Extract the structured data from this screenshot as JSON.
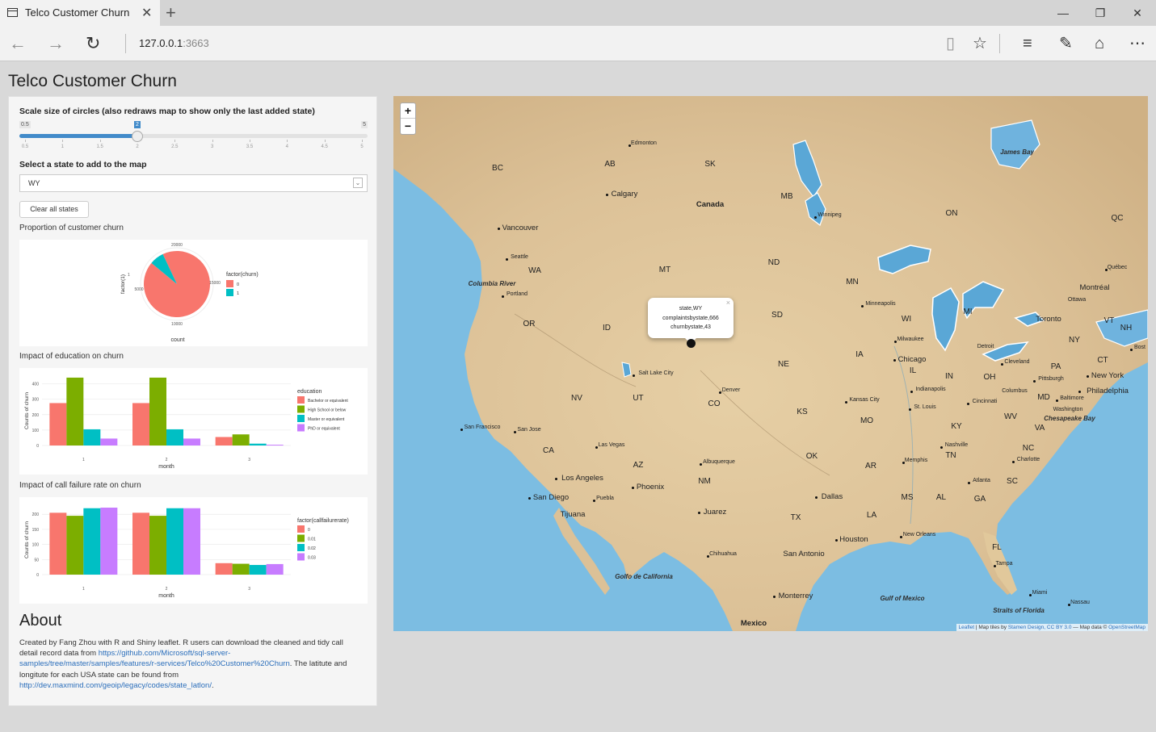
{
  "browser": {
    "tab_title": "Telco Customer Churn",
    "url_host": "127.0.0.1",
    "url_port": ":3663"
  },
  "page": {
    "title": "Telco Customer Churn"
  },
  "controls": {
    "slider_label": "Scale size of circles (also redraws map to show only the last added state)",
    "slider_min": "0.5",
    "slider_max": "5",
    "slider_value": "2",
    "slider_ticks": [
      "0.5",
      "1",
      "1.5",
      "2",
      "2.5",
      "3",
      "3.5",
      "4",
      "4.5",
      "5"
    ],
    "state_label": "Select a state to add to the map",
    "state_value": "WY",
    "clear_button": "Clear all states"
  },
  "charts": {
    "pie_title": "Proportion of customer churn",
    "edu_title": "Impact of education on churn",
    "cf_title": "Impact of call failure rate on churn"
  },
  "chart_data": [
    {
      "type": "pie",
      "xlabel": "count",
      "ylabel": "factor(1)",
      "y_tick": "1",
      "ticks": [
        "20000",
        "5000",
        "10000",
        "15000"
      ],
      "legend_title": "factor(churn)",
      "series": [
        {
          "name": "0",
          "values": [
            18600
          ],
          "color": "#F8766D"
        },
        {
          "name": "1",
          "values": [
            1400
          ],
          "color": "#00BFC4"
        }
      ]
    },
    {
      "type": "bar",
      "categories": [
        "1",
        "2",
        "3"
      ],
      "xlabel": "month",
      "ylabel": "Counts of churn",
      "ylim": [
        0,
        450
      ],
      "yticks": [
        "0",
        "100",
        "200",
        "300",
        "400"
      ],
      "legend_title": "education",
      "series": [
        {
          "name": "Bachelor or equivalent",
          "values": [
            275,
            275,
            55
          ],
          "color": "#F8766D"
        },
        {
          "name": "High School or below",
          "values": [
            440,
            440,
            72
          ],
          "color": "#7CAE00"
        },
        {
          "name": "Master or equivalent",
          "values": [
            105,
            105,
            12
          ],
          "color": "#00BFC4"
        },
        {
          "name": "PhD or equivalent",
          "values": [
            45,
            45,
            5
          ],
          "color": "#C77CFF"
        }
      ]
    },
    {
      "type": "bar",
      "categories": [
        "1",
        "2",
        "3"
      ],
      "xlabel": "month",
      "ylabel": "Counts of churn",
      "ylim": [
        0,
        230
      ],
      "yticks": [
        "0",
        "50",
        "100",
        "150",
        "200"
      ],
      "legend_title": "factor(callfailurerate)",
      "series": [
        {
          "name": "0",
          "values": [
            205,
            205,
            38
          ],
          "color": "#F8766D"
        },
        {
          "name": "0.01",
          "values": [
            195,
            195,
            36
          ],
          "color": "#7CAE00"
        },
        {
          "name": "0.02",
          "values": [
            220,
            220,
            32
          ],
          "color": "#00BFC4"
        },
        {
          "name": "0.03",
          "values": [
            222,
            220,
            35
          ],
          "color": "#C77CFF"
        }
      ]
    }
  ],
  "about": {
    "heading": "About",
    "text1": "Created by Fang Zhou with R and Shiny leaflet. R users can download the cleaned and tidy call detail record data from ",
    "link1": "https://github.com/Microsoft/sql-server-samples/tree/master/samples/features/r-services/Telco%20Customer%20Churn",
    "text2": ". The latitute and longitute for each USA state can be found from ",
    "link2": "http://dev.maxmind.com/geoip/legacy/codes/state_latlon/",
    "text3": "."
  },
  "map": {
    "zoom_in": "+",
    "zoom_out": "−",
    "popup_close": "×",
    "popup_lines": [
      "state,WY",
      "complaintsbystate,666",
      "churnbystate,43"
    ],
    "attribution_pre": "Leaflet",
    "attribution_mid": " | Map tiles by ",
    "attribution_link": "Stamen Design, CC BY 3.0",
    "attribution_post": " — Map data © ",
    "attribution_osm": "OpenStreetMap",
    "labels": [
      "Edmonton",
      "James Bay",
      "BC",
      "AB",
      "SK",
      "Calgary",
      "Canada",
      "MB",
      "Winnipeg",
      "ON",
      "QC",
      "Vancouver",
      "Seattle",
      "WA",
      "Columbia River",
      "Portland",
      "OR",
      "ID",
      "MT",
      "ND",
      "MN",
      "Minneapolis",
      "Québec",
      "Montréal",
      "Ottawa",
      "SD",
      "WI",
      "MI",
      "Toronto",
      "VT",
      "NH",
      "Milwaukee",
      "Detroit",
      "NY",
      "Bost",
      "CT",
      "Salt Lake City",
      "NE",
      "IA",
      "Chicago",
      "IL",
      "Cleveland",
      "PA",
      "New York",
      "IN",
      "OH",
      "Pittsburgh",
      "Philadelphia",
      "Denver",
      "Indianapolis",
      "Columbus",
      "Baltimore",
      "MD",
      "NV",
      "UT",
      "CO",
      "Kansas City",
      "KS",
      "St. Louis",
      "Cincinnati",
      "Washington",
      "WV",
      "Chesapeake Bay",
      "MO",
      "KY",
      "VA",
      "San Francisco",
      "San Jose",
      "CA",
      "Las Vegas",
      "Nashville",
      "TN",
      "NC",
      "Charlotte",
      "AZ",
      "Albuquerque",
      "OK",
      "AR",
      "Memphis",
      "Los Angeles",
      "Phoenix",
      "NM",
      "Atlanta",
      "SC",
      "San Diego",
      "Puebla",
      "Tijuana",
      "Dallas",
      "MS",
      "AL",
      "GA",
      "Juarez",
      "TX",
      "LA",
      "Houston",
      "New Orleans",
      "FL",
      "Chihuahua",
      "San Antonio",
      "Tampa",
      "Golfo de California",
      "Monterrey",
      "Gulf of Mexico",
      "Miami",
      "Nassau",
      "Straits of Florida",
      "Mexico"
    ]
  }
}
